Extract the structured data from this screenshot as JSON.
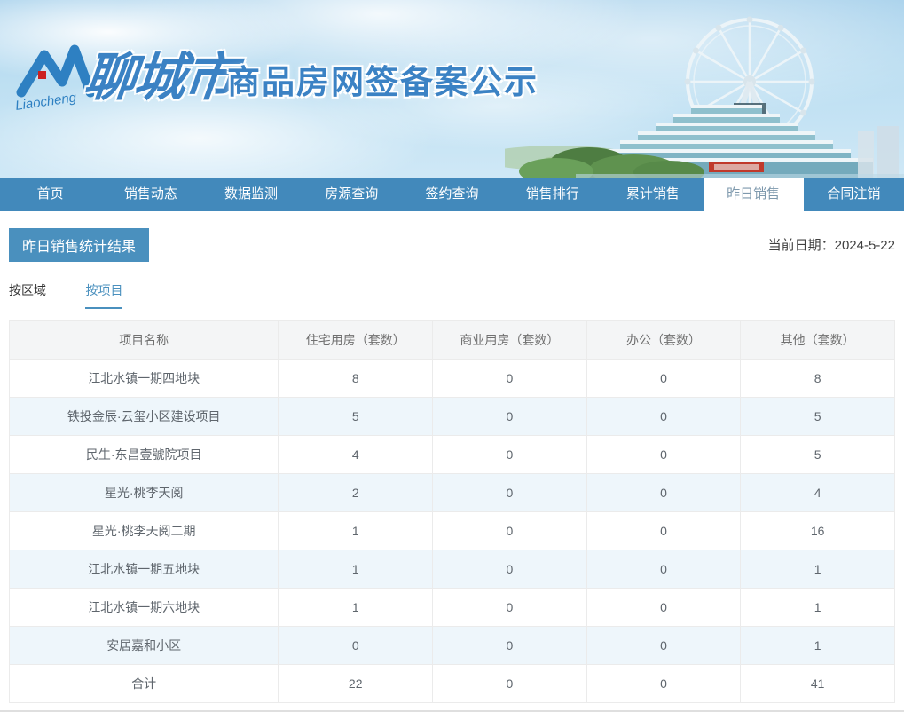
{
  "banner": {
    "logo_script": "Liaocheng",
    "city": "聊城市",
    "title": "商品房网签备案公示"
  },
  "nav": {
    "items": [
      {
        "label": "首页",
        "active": false
      },
      {
        "label": "销售动态",
        "active": false
      },
      {
        "label": "数据监测",
        "active": false
      },
      {
        "label": "房源查询",
        "active": false
      },
      {
        "label": "签约查询",
        "active": false
      },
      {
        "label": "销售排行",
        "active": false
      },
      {
        "label": "累计销售",
        "active": false
      },
      {
        "label": "昨日销售",
        "active": true
      },
      {
        "label": "合同注销",
        "active": false
      }
    ]
  },
  "content": {
    "section_title": "昨日销售统计结果",
    "current_date": "当前日期：2024-5-22",
    "tabs": [
      {
        "label": "按区域",
        "active": false
      },
      {
        "label": "按项目",
        "active": true
      }
    ]
  },
  "table": {
    "headers": [
      "项目名称",
      "住宅用房（套数）",
      "商业用房（套数）",
      "办公（套数）",
      "其他（套数）"
    ],
    "rows": [
      [
        "江北水镇一期四地块",
        "8",
        "0",
        "0",
        "8"
      ],
      [
        "铁投金辰·云玺小区建设项目",
        "5",
        "0",
        "0",
        "5"
      ],
      [
        "民生·东昌壹號院项目",
        "4",
        "0",
        "0",
        "5"
      ],
      [
        "星光·桃李天阅",
        "2",
        "0",
        "0",
        "4"
      ],
      [
        "星光·桃李天阅二期",
        "1",
        "0",
        "0",
        "16"
      ],
      [
        "江北水镇一期五地块",
        "1",
        "0",
        "0",
        "1"
      ],
      [
        "江北水镇一期六地块",
        "1",
        "0",
        "0",
        "1"
      ],
      [
        "安居嘉和小区",
        "0",
        "0",
        "0",
        "1"
      ],
      [
        "合计",
        "22",
        "0",
        "0",
        "41"
      ]
    ]
  },
  "colors": {
    "nav_blue": "#4289bb",
    "accent_blue": "#4a90be",
    "active_nav_text": "#7e99ad",
    "banner_text_blue": "#3b82c4",
    "alt_row_bg": "#eef6fb",
    "logo_red": "#cc2020"
  }
}
